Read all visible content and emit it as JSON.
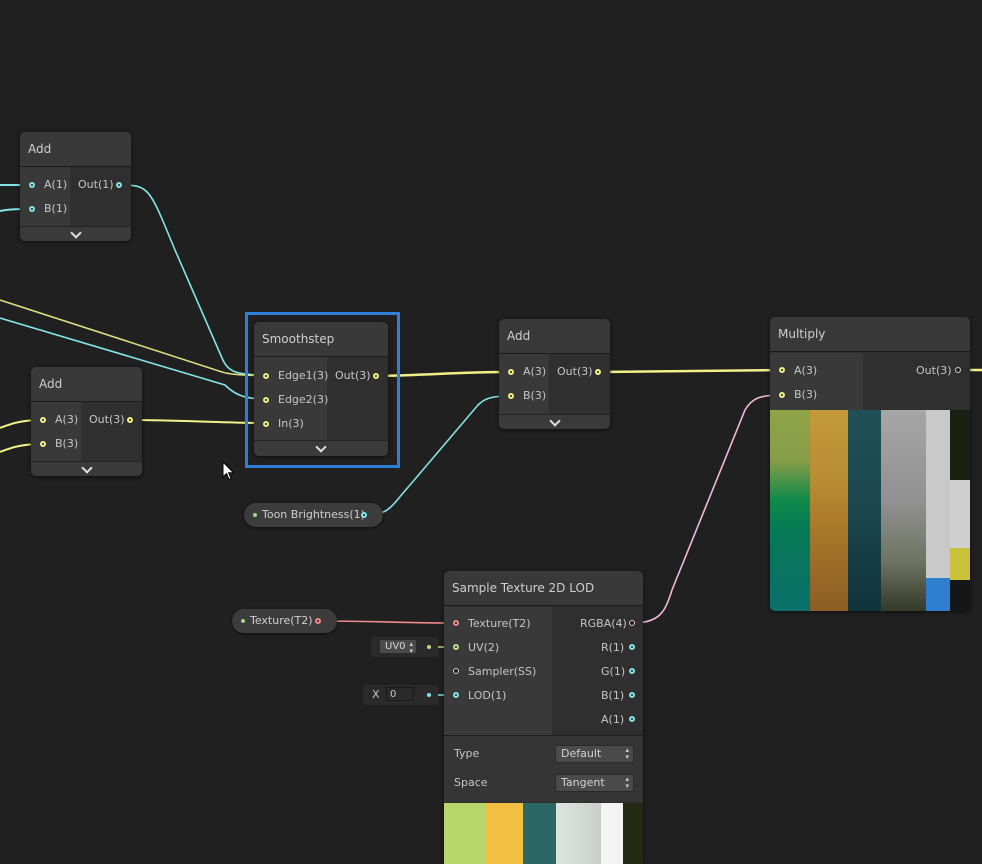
{
  "nodes": {
    "add1": {
      "title": "Add",
      "inputs": [
        "A(1)",
        "B(1)"
      ],
      "output": "Out(1)"
    },
    "add2": {
      "title": "Add",
      "inputs": [
        "A(3)",
        "B(3)"
      ],
      "output": "Out(3)"
    },
    "smoothstep": {
      "title": "Smoothstep",
      "inputs": [
        "Edge1(3)",
        "Edge2(3)",
        "In(3)"
      ],
      "output": "Out(3)"
    },
    "add3": {
      "title": "Add",
      "inputs": [
        "A(3)",
        "B(3)"
      ],
      "output": "Out(3)"
    },
    "multiply": {
      "title": "Multiply",
      "inputs": [
        "A(3)",
        "B(3)"
      ],
      "output": "Out(3)"
    },
    "sample_texture": {
      "title": "Sample Texture 2D LOD",
      "inputs": [
        "Texture(T2)",
        "UV(2)",
        "Sampler(SS)",
        "LOD(1)"
      ],
      "outputs": [
        "RGBA(4)",
        "R(1)",
        "G(1)",
        "B(1)",
        "A(1)"
      ],
      "type_label": "Type",
      "type_value": "Default",
      "space_label": "Space",
      "space_value": "Tangent"
    }
  },
  "properties": {
    "toon_brightness": "Toon Brightness(1)",
    "texture": "Texture(T2)"
  },
  "inline_inputs": {
    "uv_value": "UV0",
    "lod_prefix": "X",
    "lod_value": "0"
  },
  "colors": {
    "background": "#202020",
    "wire_vector3": "#f3f08a",
    "wire_vector1": "#84e4e7",
    "wire_texture": "#f08a8a",
    "wire_vector4": "#f4b9d8",
    "selection": "#2f7fd8"
  }
}
